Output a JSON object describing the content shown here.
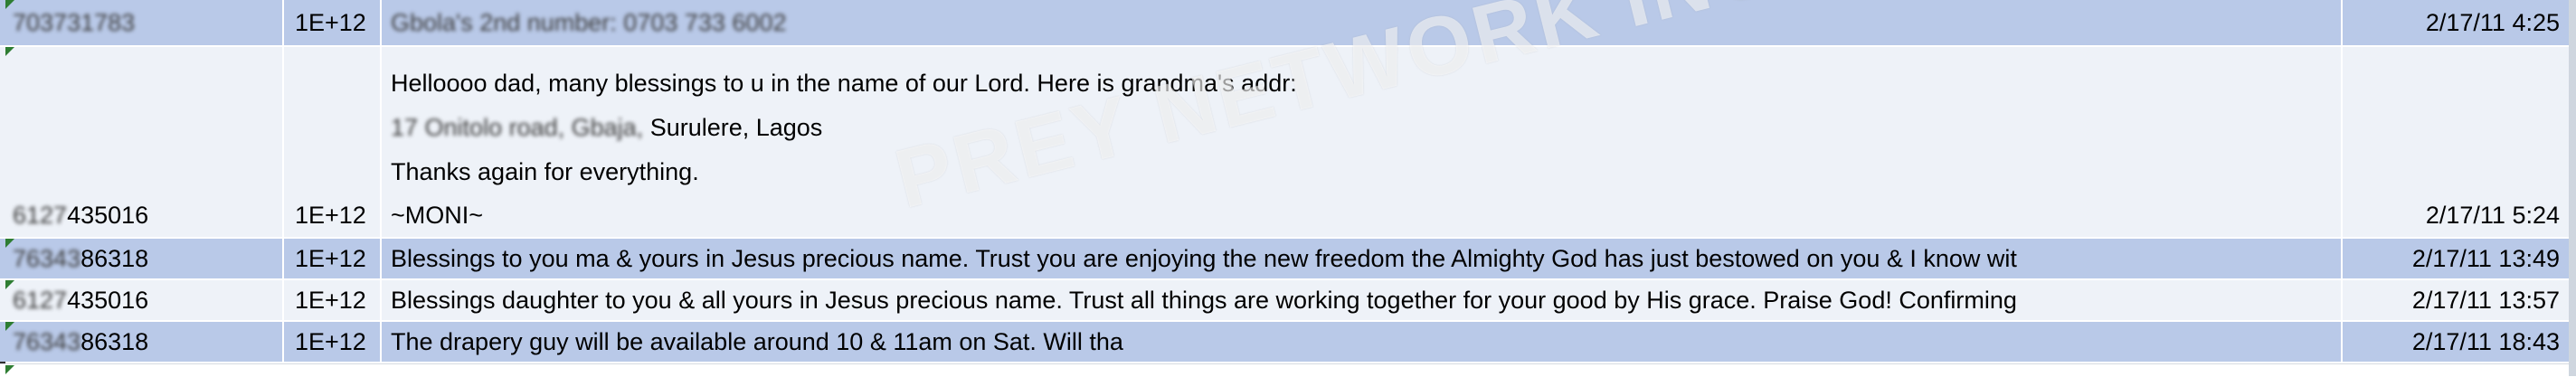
{
  "rows": [
    {
      "phone": "703731783",
      "value": "1E+12",
      "message_lines": [
        "Gbola's 2nd number: 0703 733 6002"
      ],
      "date": "2/17/11 4:25"
    },
    {
      "phone_blur": "6127",
      "phone_clear": "435016",
      "value": "1E+12",
      "message_lines": [
        "Helloooo dad, many blessings to u in the name of our Lord. Here is grandma's addr:",
        " 17 Onitolo road, Gbaja, Surulere, Lagos",
        "Thanks again for everything.",
        "~MONI~"
      ],
      "address_blur": " 17 Onitolo road, Gbaja,",
      "address_clear": " Surulere, Lagos",
      "date": "2/17/11 5:24"
    },
    {
      "phone_blur": "76343",
      "phone_clear": "86318",
      "value": "1E+12",
      "message": "Blessings to you ma & yours in Jesus precious name. Trust you are enjoying the new freedom the Almighty God has just bestowed on you & I know wit",
      "date": "2/17/11 13:49"
    },
    {
      "phone_blur": "6127",
      "phone_clear": "435016",
      "value": "1E+12",
      "message": "Blessings daughter to you & all yours in Jesus precious name. Trust all things are working together for your good by His grace. Praise God! Confirming",
      "date": "2/17/11 13:57"
    },
    {
      "phone_blur": "76343",
      "phone_clear": "86318",
      "value": "1E+12",
      "message": "The drapery guy will be available around 10 & 11am on Sat. Will tha",
      "date": "2/17/11 18:43"
    }
  ],
  "watermark": "PREY NETWORK INC",
  "colors": {
    "highlight_row": "#b9c9e8",
    "plain_row": "#eef2f8",
    "cell_marker": "#2e7d32"
  }
}
